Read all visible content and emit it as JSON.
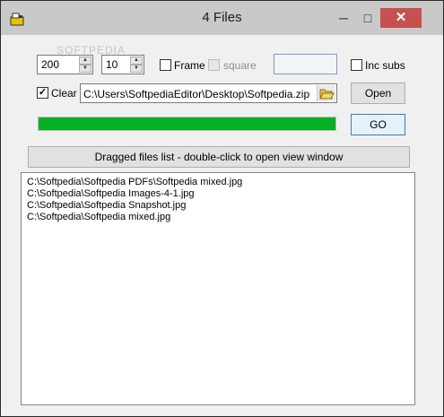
{
  "window": {
    "title": "4 Files",
    "controls": {
      "minimize": "─",
      "maximize": "□",
      "close": "✕"
    }
  },
  "watermark": "SOFTPEDIA",
  "controls": {
    "spin1_value": "200",
    "spin2_value": "10",
    "frame_label": "Frame",
    "frame_checked": false,
    "square_label": "square",
    "square_checked": false,
    "inc_subs_label": "Inc subs",
    "inc_subs_checked": false,
    "clear_label": "Clear",
    "clear_checked": true,
    "path_value": "C:\\Users\\SoftpediaEditor\\Desktop\\Softpedia.zip",
    "open_label": "Open",
    "go_label": "GO",
    "progress_fraction": 1.0
  },
  "dragged_list_button": "Dragged files list - double-click to open view  window",
  "files": [
    "C:\\Softpedia\\Softpedia PDFs\\Softpedia mixed.jpg",
    "C:\\Softpedia\\Softpedia Images-4-1.jpg",
    "C:\\Softpedia\\Softpedia Snapshot.jpg",
    "C:\\Softpedia\\Softpedia mixed.jpg"
  ],
  "icons": {
    "app": "app-icon",
    "browse": "folder-open-icon",
    "spin": "spin-arrows-icon"
  },
  "colors": {
    "progress": "#06b025",
    "close_button": "#c75050"
  }
}
